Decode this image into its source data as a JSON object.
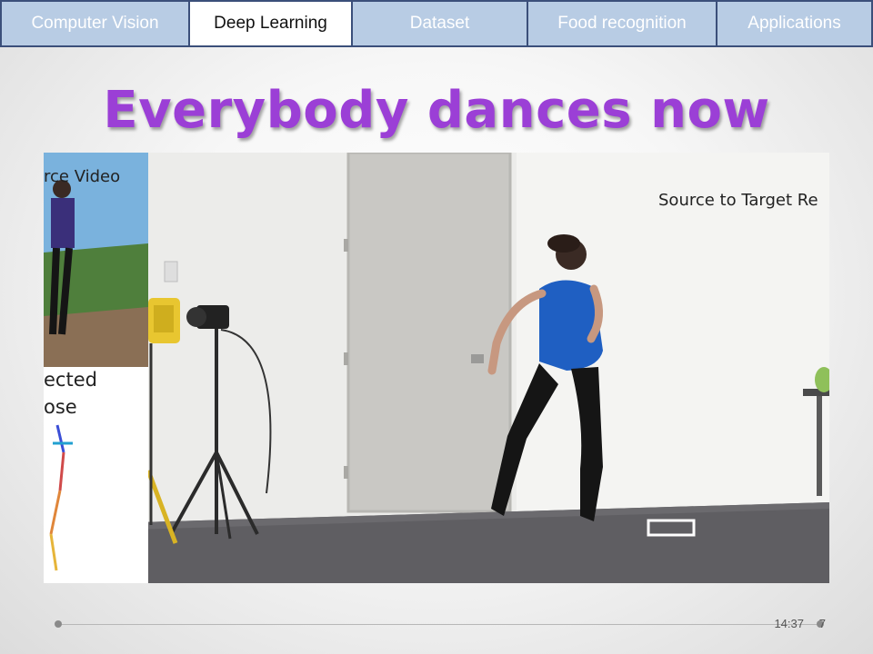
{
  "nav": {
    "tabs": [
      {
        "label": "Computer Vision",
        "active": false
      },
      {
        "label": "Deep Learning",
        "active": true
      },
      {
        "label": "Dataset",
        "active": false
      },
      {
        "label": "Food recognition",
        "active": false
      },
      {
        "label": "Applications",
        "active": false
      }
    ]
  },
  "slide": {
    "title": "Everybody dances now"
  },
  "video": {
    "inset_top_label": "rce Video",
    "inset_bottom_label_line1": "ected",
    "inset_bottom_label_line2": "ose",
    "caption": "Source to Target Re"
  },
  "footer": {
    "time": "14:37",
    "page": "7"
  },
  "colors": {
    "title": "#9b3fd6",
    "tab_inactive": "#b8cce4",
    "tab_border": "#3b4f7a"
  }
}
